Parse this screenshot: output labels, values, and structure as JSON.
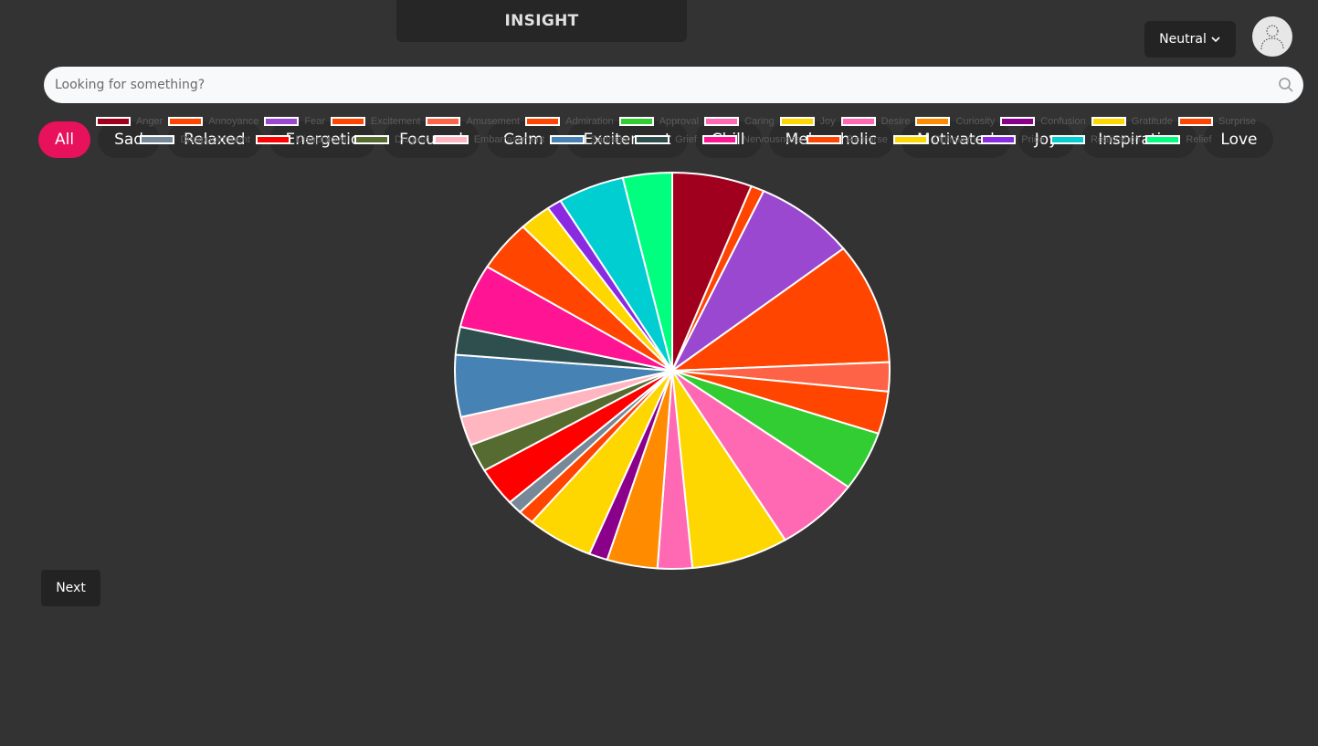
{
  "header": {
    "title": "INSIGHT"
  },
  "mood_select": {
    "value": "Neutral"
  },
  "search": {
    "placeholder": "Looking for something?"
  },
  "filters": [
    {
      "label": "All",
      "active": true
    },
    {
      "label": "Sad"
    },
    {
      "label": "Relaxed"
    },
    {
      "label": "Energetic"
    },
    {
      "label": "Focused"
    },
    {
      "label": "Calm"
    },
    {
      "label": "Excitement"
    },
    {
      "label": "Chill"
    },
    {
      "label": "Melancholic"
    },
    {
      "label": "Motivated"
    },
    {
      "label": "Joy"
    },
    {
      "label": "Inspiration"
    },
    {
      "label": "Love"
    }
  ],
  "footer": {
    "next_label": "Next"
  },
  "colors": {
    "accent": "#e8115b",
    "background": "#333333"
  },
  "chart_data": {
    "type": "pie",
    "title": "",
    "legend_position": "top",
    "categories": [
      "Anger",
      "Annoyance",
      "Fear",
      "Excitement",
      "Amusement",
      "Admiration",
      "Approval",
      "Caring",
      "Joy",
      "Desire",
      "Curiosity",
      "Confusion",
      "Gratitude",
      "Surprise",
      "Disappointment",
      "Disapproval",
      "Disgust",
      "Embarrassment",
      "Sadness",
      "Grief",
      "Nervousness",
      "Remorse",
      "Optimism",
      "Pride",
      "Realization",
      "Relief"
    ],
    "values": [
      6.0,
      1.0,
      7.6,
      10.0,
      2.4,
      3.5,
      4.9,
      6.4,
      7.3,
      2.6,
      3.8,
      1.4,
      5.0,
      1.2,
      1.1,
      3.2,
      2.3,
      2.4,
      5.1,
      2.3,
      5.3,
      4.2,
      2.4,
      1.1,
      5.0,
      3.7
    ],
    "colors": [
      "#a0001e",
      "#ff4500",
      "#9b48d0",
      "#ff4500",
      "#ff6347",
      "#ff4500",
      "#32cd32",
      "#ff69b4",
      "#ffd700",
      "#ff69b4",
      "#ff8c00",
      "#8b008b",
      "#ffd700",
      "#ff4500",
      "#778899",
      "#ff0000",
      "#556b2f",
      "#ffb6c1",
      "#4682b4",
      "#2f4f4f",
      "#ff1493",
      "#ff4500",
      "#ffd700",
      "#8a2be2",
      "#00ced1",
      "#00ff7f"
    ]
  }
}
